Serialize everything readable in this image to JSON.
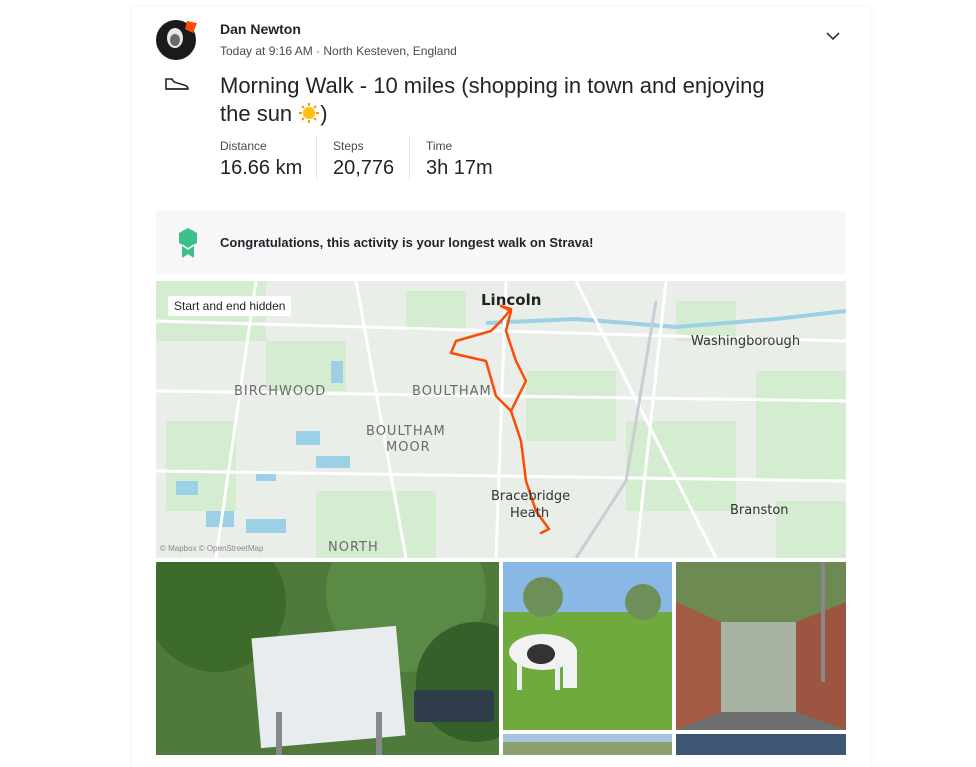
{
  "athlete": {
    "name": "Dan Newton"
  },
  "activity": {
    "meta": "Today at 9:16 AM · North Kesteven, England",
    "title_before": "Morning Walk - 10 miles (shopping in town and enjoying the sun ",
    "title_after": ")",
    "type_icon": "shoe-icon"
  },
  "stats": [
    {
      "label": "Distance",
      "value": "16.66 km"
    },
    {
      "label": "Steps",
      "value": "20,776"
    },
    {
      "label": "Time",
      "value": "3h 17m"
    }
  ],
  "achievement": {
    "text": "Congratulations, this activity is your longest walk on Strava!",
    "icon": "achievement-ribbon-icon"
  },
  "map": {
    "badge": "Start and end hidden",
    "attribution": "© Mapbox © OpenStreetMap",
    "route_color": "#fc4c02",
    "places": {
      "lincoln": "Lincoln",
      "washingborough": "Washingborough",
      "birchwood": "BIRCHWOOD",
      "boultham": "BOULTHAM",
      "boultham_moor_1": "BOULTHAM",
      "boultham_moor_2": "MOOR",
      "bracebridge_1": "Bracebridge",
      "bracebridge_2": "Heath",
      "branston": "Branston",
      "north_hykeham": "NORTH"
    }
  },
  "colors": {
    "brand": "#fc4c02",
    "achievement": "#3cc08a"
  }
}
